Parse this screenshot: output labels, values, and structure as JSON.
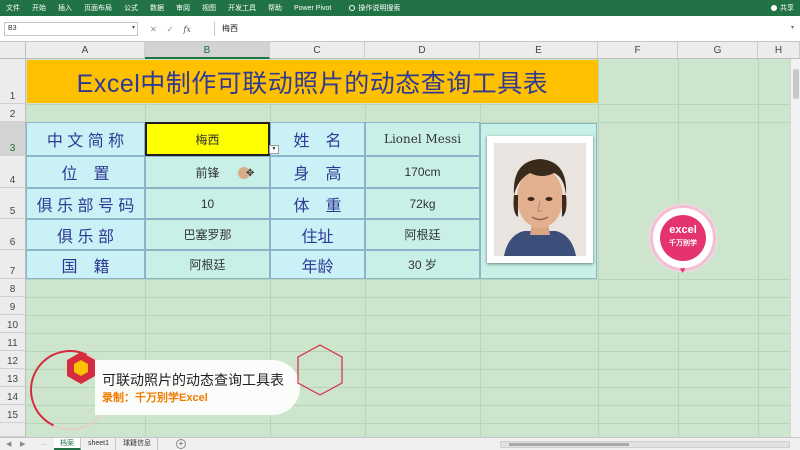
{
  "ribbon": {
    "tabs": [
      "文件",
      "开始",
      "插入",
      "页面布局",
      "公式",
      "数据",
      "审阅",
      "视图",
      "开发工具",
      "帮助",
      "Power Pivot"
    ],
    "tell_me": "操作说明搜索",
    "share": "共享",
    "bg_color": "#217346"
  },
  "formula_bar": {
    "name_box": "B3",
    "value": "梅西"
  },
  "columns": [
    "A",
    "B",
    "C",
    "D",
    "E",
    "F",
    "G",
    "H"
  ],
  "rows": [
    "1",
    "2",
    "3",
    "4",
    "5",
    "6",
    "7",
    "8",
    "9",
    "10",
    "11",
    "12",
    "13",
    "14",
    "15"
  ],
  "sheet": {
    "title": "Excel中制作可联动照片的动态查询工具表",
    "labels": {
      "short_name": "中 文 简 称",
      "position": "位　置",
      "club_number": "俱 乐 部 号 码",
      "club": "俱 乐 部",
      "nationality": "国　籍",
      "name": "姓　名",
      "height": "身　高",
      "weight": "体　重",
      "residence": "住址",
      "age": "年龄"
    },
    "values": {
      "short_name": "梅西",
      "position": "前锋",
      "club_number": "10",
      "club": "巴塞罗那",
      "nationality": "阿根廷",
      "name": "Lionel Messi",
      "height": "170cm",
      "weight": "72kg",
      "residence": "阿根廷",
      "age": "30 岁"
    }
  },
  "badge": {
    "brand": "excel",
    "subtitle": "千万别学",
    "color": "#e5336e"
  },
  "overlay": {
    "title": "可联动照片的动态查询工具表",
    "subtitle": "录制：千万别学Excel"
  },
  "sheet_tabs": [
    "档案",
    "sheet1",
    "球籍信息"
  ],
  "active_sheet_index": 0
}
